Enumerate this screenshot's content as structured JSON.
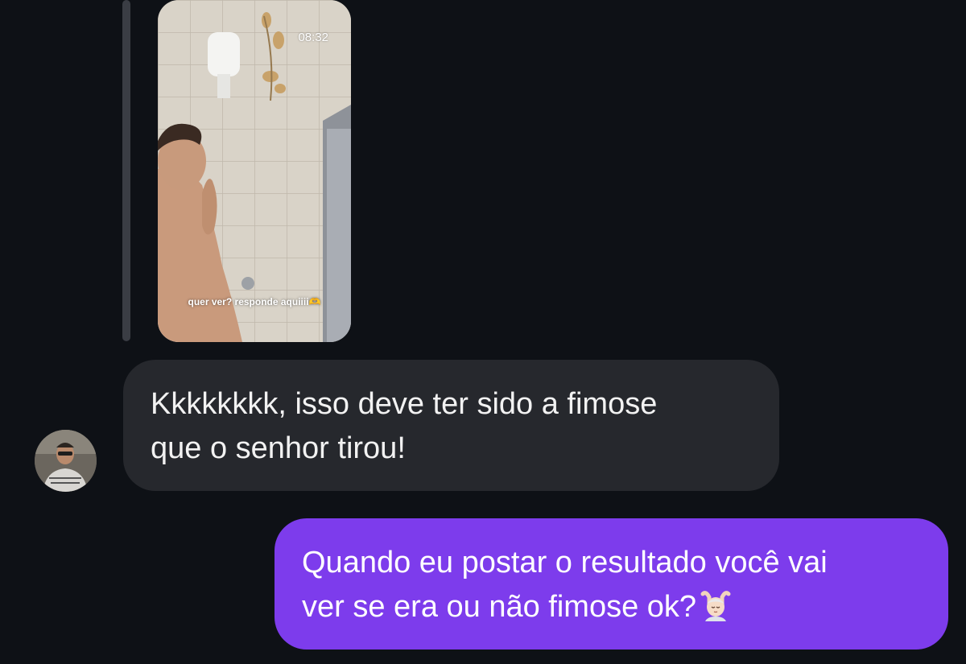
{
  "story": {
    "time": "08:32",
    "caption": "quer ver? responde aquiiii🫶"
  },
  "messages": {
    "incoming": {
      "line1": "Kkkkkkkk, isso deve ter sido a fimose",
      "line2": "que o senhor tirou!"
    },
    "outgoing": {
      "line1": "Quando eu postar o resultado você vai",
      "line2": "ver se era ou não fimose ok?",
      "emoji": "💆🏻‍♂️"
    }
  },
  "colors": {
    "background": "#0e1116",
    "incoming_bubble": "#26282d",
    "outgoing_bubble": "#7d3cec"
  },
  "icons": {
    "emoji": "face-massage-emoji"
  }
}
